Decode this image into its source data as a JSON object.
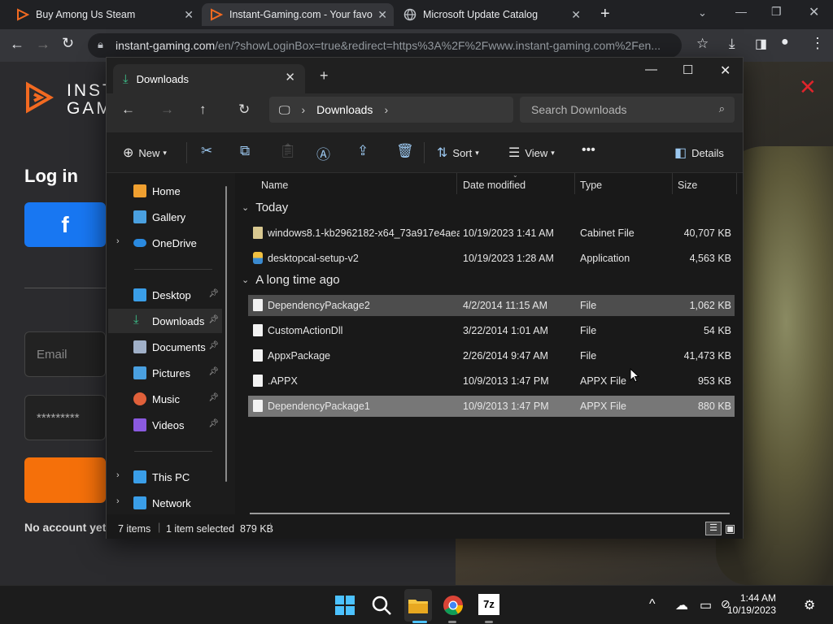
{
  "browser": {
    "tabs": [
      {
        "title": "Buy Among Us Steam",
        "active": false
      },
      {
        "title": "Instant-Gaming.com - Your favo",
        "active": true
      },
      {
        "title": "Microsoft Update Catalog",
        "active": false
      }
    ],
    "url_host": "instant-gaming.com",
    "url_path": "/en/?showLoginBox=true&redirect=https%3A%2F%2Fwww.instant-gaming.com%2Fen..."
  },
  "site": {
    "logo_line1": "INST",
    "logo_line2": "GAM",
    "login_title": "Log in",
    "facebook_glyph": "f",
    "email_placeholder": "Email",
    "password_mask": "*********",
    "no_account_text": "No account yet?"
  },
  "explorer": {
    "tab_title": "Downloads",
    "breadcrumb": "Downloads",
    "search_placeholder": "Search Downloads",
    "commands": {
      "new": "New",
      "sort": "Sort",
      "view": "View",
      "details": "Details"
    },
    "sidebar": [
      {
        "label": "Home",
        "icon": "home-icon",
        "color": "#f0a030"
      },
      {
        "label": "Gallery",
        "icon": "gallery-icon",
        "color": "#4aa0e0"
      },
      {
        "label": "OneDrive",
        "icon": "cloud-icon",
        "color": "#2a8ae0",
        "expandable": true
      },
      {
        "label": "Desktop",
        "icon": "desktop-icon",
        "color": "#3a9ee8",
        "pinned": true
      },
      {
        "label": "Downloads",
        "icon": "download-icon",
        "color": "#3cc08a",
        "pinned": true,
        "selected": true
      },
      {
        "label": "Documents",
        "icon": "documents-icon",
        "color": "#a0b0c8",
        "pinned": true
      },
      {
        "label": "Pictures",
        "icon": "pictures-icon",
        "color": "#4aa0e0",
        "pinned": true
      },
      {
        "label": "Music",
        "icon": "music-icon",
        "color": "#e0603a",
        "pinned": true
      },
      {
        "label": "Videos",
        "icon": "videos-icon",
        "color": "#8a5ae0",
        "pinned": true
      },
      {
        "label": "This PC",
        "icon": "pc-icon",
        "color": "#3a9ee8",
        "expandable": true
      },
      {
        "label": "Network",
        "icon": "network-icon",
        "color": "#3a9ee8",
        "expandable": true
      }
    ],
    "columns": {
      "name": "Name",
      "date": "Date modified",
      "type": "Type",
      "size": "Size"
    },
    "groups": [
      {
        "label": "Today",
        "files": [
          {
            "name": "windows8.1-kb2962182-x64_73a917e4aea...",
            "date": "10/19/2023 1:41 AM",
            "type": "Cabinet File",
            "size": "40,707 KB"
          },
          {
            "name": "desktopcal-setup-v2",
            "date": "10/19/2023 1:28 AM",
            "type": "Application",
            "size": "4,563 KB"
          }
        ]
      },
      {
        "label": "A long time ago",
        "files": [
          {
            "name": "DependencyPackage2",
            "date": "4/2/2014 11:15 AM",
            "type": "File",
            "size": "1,062 KB",
            "state": "hover"
          },
          {
            "name": "CustomActionDll",
            "date": "3/22/2014 1:01 AM",
            "type": "File",
            "size": "54 KB"
          },
          {
            "name": "AppxPackage",
            "date": "2/26/2014 9:47 AM",
            "type": "File",
            "size": "41,473 KB"
          },
          {
            "name": ".APPX",
            "date": "10/9/2013 1:47 PM",
            "type": "APPX File",
            "size": "953 KB"
          },
          {
            "name": "DependencyPackage1",
            "date": "10/9/2013 1:47 PM",
            "type": "APPX File",
            "size": "880 KB",
            "state": "selected"
          }
        ]
      }
    ],
    "status": {
      "count": "7 items",
      "selection": "1 item selected  879 KB"
    }
  },
  "taskbar": {
    "time": "1:44 AM",
    "date": "10/19/2023",
    "apps": [
      "windows-start-icon",
      "search-icon",
      "file-explorer-icon",
      "chrome-icon",
      "7zip-icon"
    ]
  }
}
